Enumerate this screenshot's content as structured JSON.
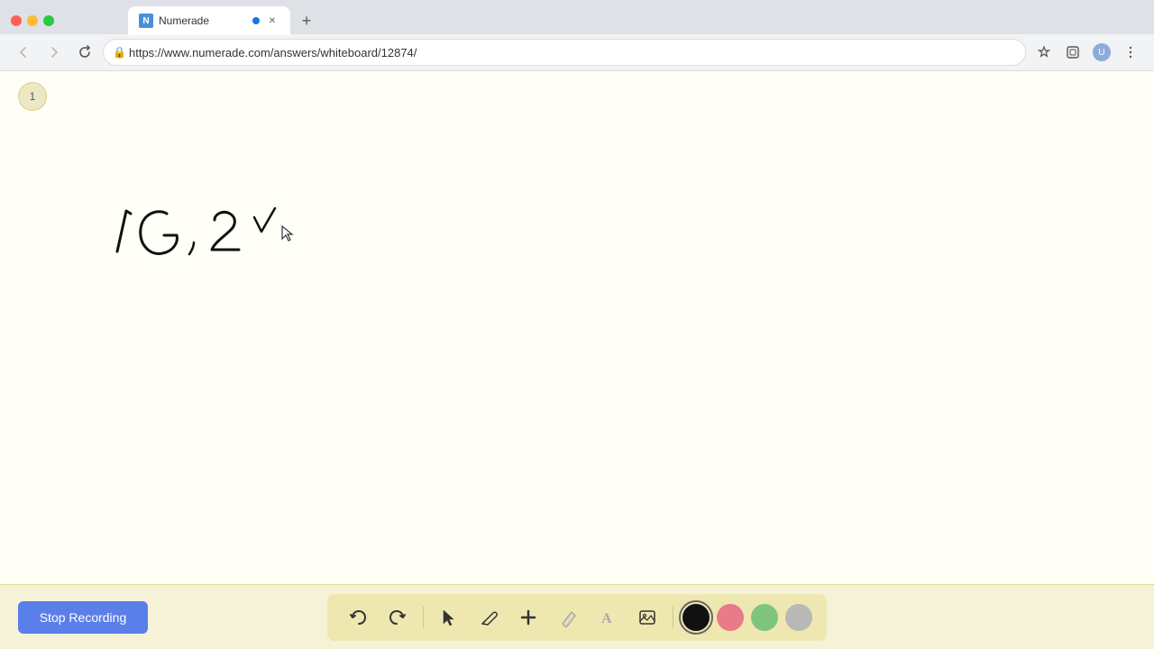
{
  "browser": {
    "url": "https://www.numerade.com/answers/whiteboard/12874/",
    "tab_title": "Numerade",
    "favicon_text": "N",
    "new_tab_label": "+",
    "nav": {
      "back_label": "‹",
      "forward_label": "›",
      "reload_label": "↻"
    }
  },
  "page": {
    "number": "1",
    "background_color": "#fffff8"
  },
  "toolbar": {
    "stop_recording_label": "Stop Recording",
    "tools": [
      {
        "name": "undo",
        "icon": "↺",
        "label": "Undo"
      },
      {
        "name": "redo",
        "icon": "↻",
        "label": "Redo"
      },
      {
        "name": "select",
        "icon": "↖",
        "label": "Select"
      },
      {
        "name": "pen",
        "icon": "✏",
        "label": "Pen"
      },
      {
        "name": "add",
        "icon": "+",
        "label": "Add"
      },
      {
        "name": "eraser",
        "icon": "/",
        "label": "Eraser"
      },
      {
        "name": "text",
        "icon": "A",
        "label": "Text"
      },
      {
        "name": "image",
        "icon": "⬜",
        "label": "Image"
      }
    ],
    "colors": [
      {
        "name": "black",
        "hex": "#111111"
      },
      {
        "name": "pink",
        "hex": "#e87a8a"
      },
      {
        "name": "green",
        "hex": "#7ec47e"
      },
      {
        "name": "gray",
        "hex": "#b8b8b8"
      }
    ]
  }
}
